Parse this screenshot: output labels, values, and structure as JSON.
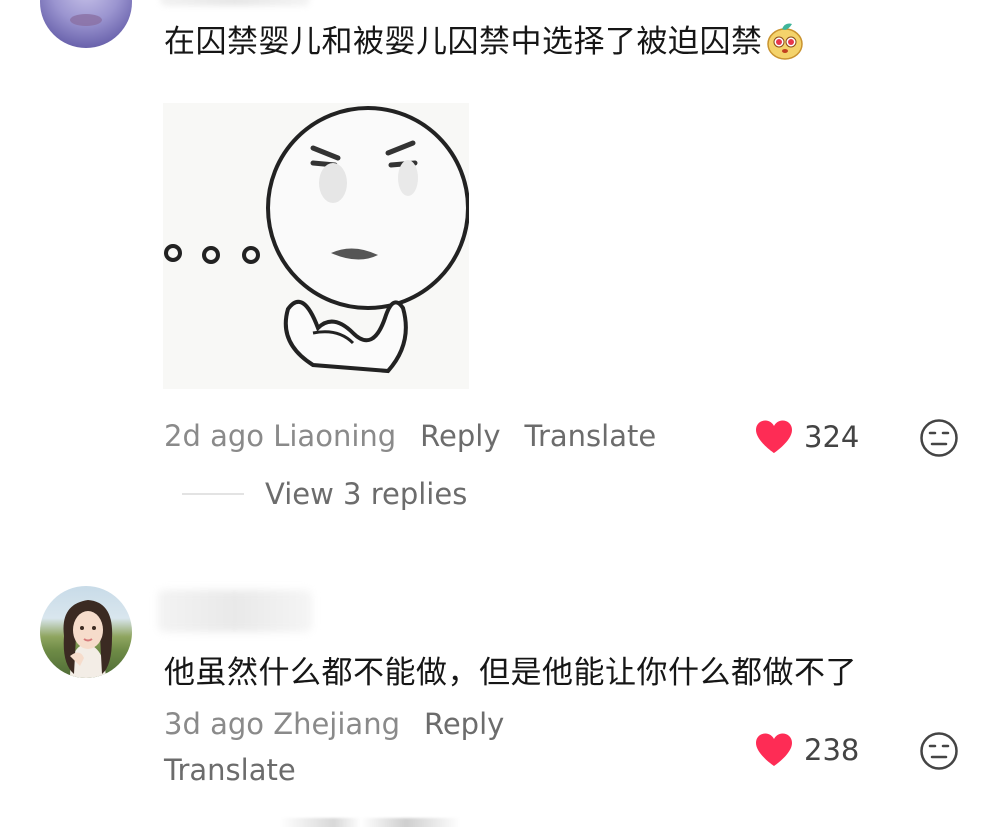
{
  "comments": [
    {
      "text": "在囚禁婴儿和被婴儿囚禁中选择了被迫囚禁",
      "emoji": "mango-face-emoji",
      "image": "meme-sticker",
      "time": "2d ago",
      "location": "Liaoning",
      "reply_label": "Reply",
      "translate_label": "Translate",
      "likes": "324",
      "view_replies": "View 3 replies"
    },
    {
      "text": "他虽然什么都不能做，但是他能让你什么都做不了",
      "time": "3d ago",
      "location": "Zhejiang",
      "reply_label": "Reply",
      "translate_label": "Translate",
      "likes": "238"
    }
  ],
  "colors": {
    "heart": "#fe2c55",
    "meta": "#8a8a8a",
    "action": "#6c6c6c",
    "text": "#161616"
  },
  "icons": {
    "like": "heart-icon",
    "dislike": "expressionless-face-icon"
  }
}
